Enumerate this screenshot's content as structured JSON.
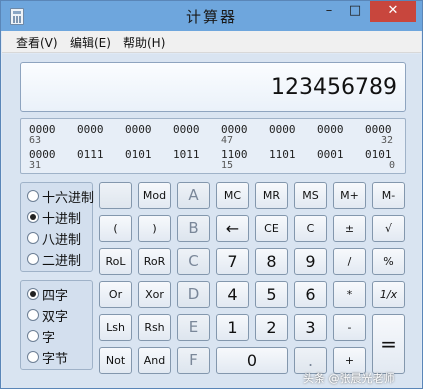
{
  "window": {
    "title": "计算器",
    "minimize_label": "–",
    "maximize_label": "□",
    "close_label": "✕"
  },
  "menu": [
    {
      "label": "查看(V)"
    },
    {
      "label": "编辑(E)"
    },
    {
      "label": "帮助(H)"
    }
  ],
  "display": {
    "value": "123456789"
  },
  "binary": {
    "row1_groups": [
      "0000",
      "0000",
      "0000",
      "0000",
      "0000",
      "0000",
      "0000",
      "0000"
    ],
    "row1_indices": [
      "63",
      "47",
      "32"
    ],
    "row2_groups": [
      "0000",
      "0111",
      "0101",
      "1011",
      "1100",
      "1101",
      "0001",
      "0101"
    ],
    "row2_indices": [
      "31",
      "15",
      "0"
    ]
  },
  "base_options": [
    {
      "label": "十六进制",
      "selected": false
    },
    {
      "label": "十进制",
      "selected": true
    },
    {
      "label": "八进制",
      "selected": false
    },
    {
      "label": "二进制",
      "selected": false
    }
  ],
  "word_options": [
    {
      "label": "四字",
      "selected": true
    },
    {
      "label": "双字",
      "selected": false
    },
    {
      "label": "字",
      "selected": false
    },
    {
      "label": "字节",
      "selected": false
    }
  ],
  "keys": {
    "blank": "",
    "mod": "Mod",
    "a": "A",
    "mc": "MC",
    "mr": "MR",
    "ms": "MS",
    "mplus": "M+",
    "mminus": "M-",
    "lparen": "(",
    "rparen": ")",
    "b": "B",
    "back": "←",
    "ce": "CE",
    "c": "C",
    "plusminus": "±",
    "sqrt": "√",
    "rol": "RoL",
    "ror": "RoR",
    "hc": "C",
    "d7": "7",
    "d8": "8",
    "d9": "9",
    "div": "/",
    "pct": "%",
    "or": "Or",
    "xor": "Xor",
    "d": "D",
    "d4": "4",
    "d5": "5",
    "d6": "6",
    "mul": "*",
    "recip": "1/x",
    "lsh": "Lsh",
    "rsh": "Rsh",
    "e": "E",
    "d1": "1",
    "d2": "2",
    "d3": "3",
    "minus": "-",
    "eq": "=",
    "not": "Not",
    "and": "And",
    "f": "F",
    "d0": "0",
    "dot": ".",
    "plus": "+"
  },
  "watermark": "头条 @张晨光老师"
}
